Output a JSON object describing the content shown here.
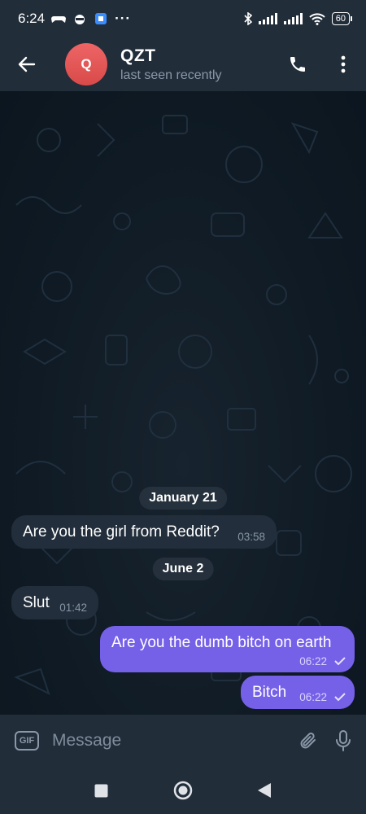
{
  "status_bar": {
    "time": "6:24",
    "battery": "60",
    "more": "···"
  },
  "header": {
    "avatar_letter": "Q",
    "name": "QZT",
    "status": "last seen recently"
  },
  "messages": [
    {
      "type": "date",
      "text": "January 21"
    },
    {
      "type": "incoming",
      "text": "Are you the girl from Reddit?",
      "time": "03:58"
    },
    {
      "type": "date",
      "text": "June 2"
    },
    {
      "type": "incoming",
      "text": "Slut",
      "time": "01:42"
    },
    {
      "type": "outgoing",
      "text": "Are you the dumb bitch on earth",
      "time": "06:22"
    },
    {
      "type": "outgoing",
      "text": "Bitch",
      "time": "06:22"
    }
  ],
  "composer": {
    "gif_label": "GIF",
    "placeholder": "Message"
  },
  "colors": {
    "outgoing_bubble": "#7560e8",
    "incoming_bubble": "#222e3b",
    "header": "#222d3a",
    "avatar": "#e05555"
  }
}
